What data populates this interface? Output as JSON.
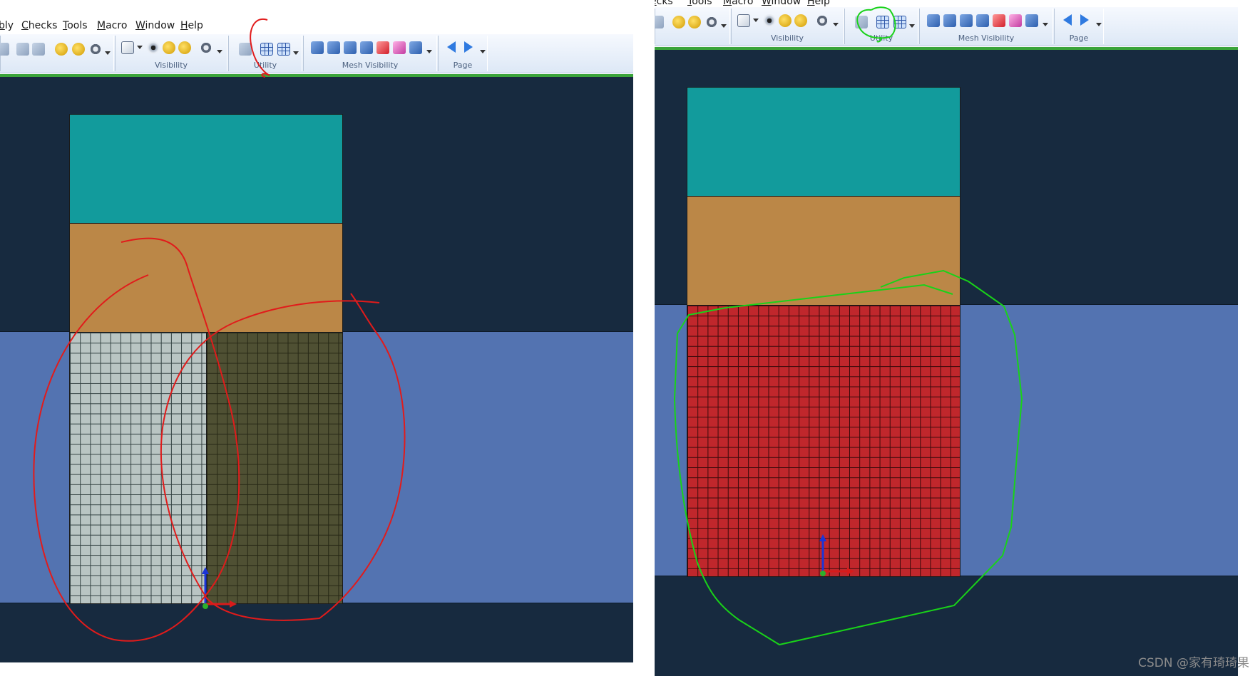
{
  "left_panel": {
    "menu": [
      "bly",
      "Checks",
      "Tools",
      "Macro",
      "Window",
      "Help"
    ],
    "groups": [
      "Visibility",
      "Utility",
      "Mesh Visibility",
      "Page"
    ],
    "annotation_color": "#e11b1b",
    "mesh_colors": {
      "left_half": "#b9c5c3",
      "right_half": "#4f5033"
    }
  },
  "right_panel": {
    "menu": [
      "ecks",
      "Tools",
      "Macro",
      "Window",
      "Help"
    ],
    "groups": [
      "Visibility",
      "Utility",
      "Mesh Visibility",
      "Page"
    ],
    "annotation_color": "#19d219",
    "mesh_colors": {
      "single": "#c0272c"
    }
  },
  "colors": {
    "viewport_bg": "#172a3f",
    "band": "#5373b1",
    "teal_block": "#129b9c",
    "tan_block": "#bb8747",
    "ribbon_separator": "#3aa43a"
  },
  "icons": [
    "grid-icon",
    "mesh-visibility-icon",
    "arrow-left-icon",
    "arrow-right-icon",
    "eye-icon",
    "gear-icon",
    "triad-axis-icon"
  ],
  "watermark": "CSDN @家有琦琦果"
}
